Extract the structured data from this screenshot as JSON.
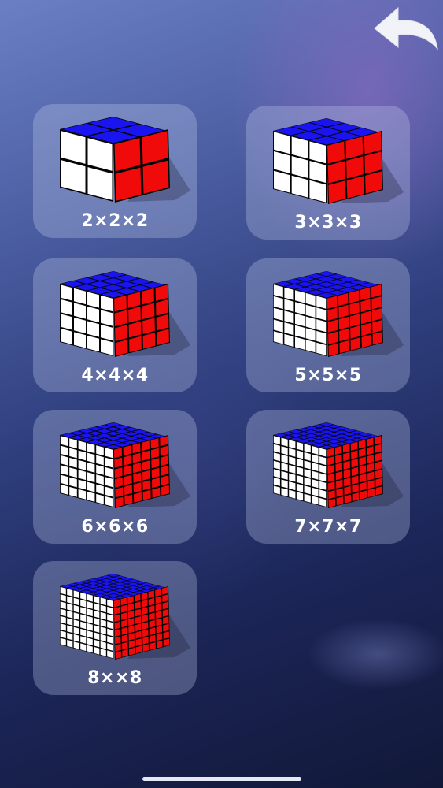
{
  "nav": {
    "back_icon": "curved-back-arrow-icon"
  },
  "colors": {
    "top": "#1a14f0",
    "left": "#ffffff",
    "right": "#f00a0a",
    "label": "#ffffff"
  },
  "levels": [
    {
      "label": "2×2×2",
      "size": 2
    },
    {
      "label": "3×3×3",
      "size": 3
    },
    {
      "label": "4×4×4",
      "size": 4
    },
    {
      "label": "5×5×5",
      "size": 5
    },
    {
      "label": "6×6×6",
      "size": 6
    },
    {
      "label": "7×7×7",
      "size": 7
    },
    {
      "label": "8××8",
      "size": 8
    }
  ]
}
